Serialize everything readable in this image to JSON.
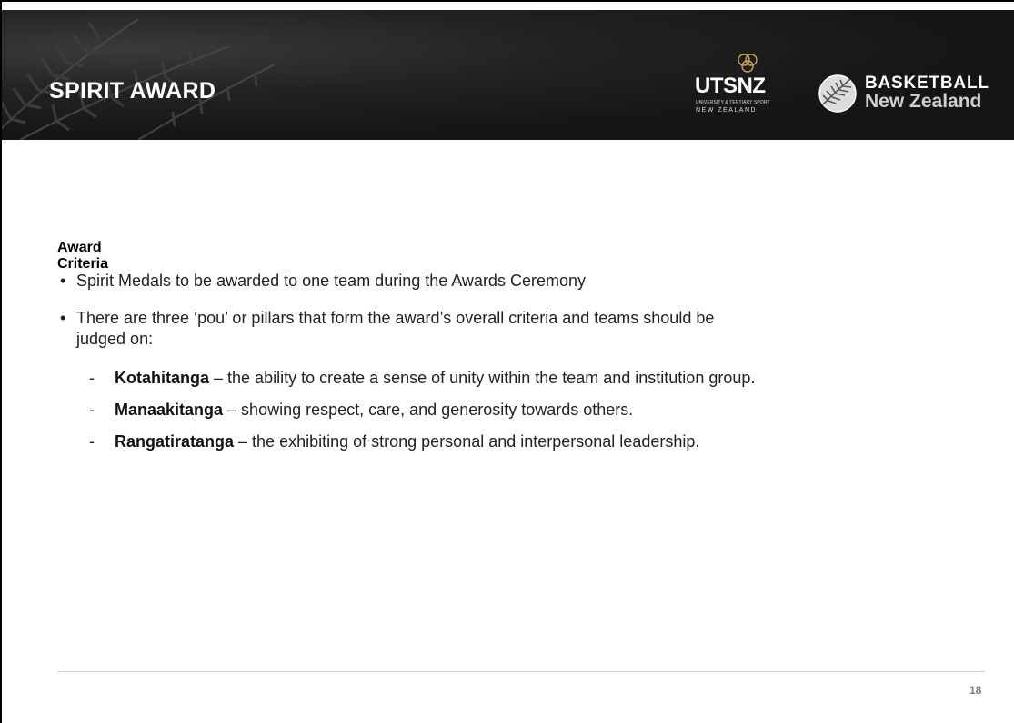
{
  "header": {
    "title": "SPIRIT AWARD",
    "logos": {
      "utsnz": {
        "word": "UTSNZ",
        "subline1": "UNIVERSITY & TERTIARY SPORT",
        "subline2": "NEW ZEALAND"
      },
      "bnz": {
        "line1": "BASKETBALL",
        "line2": "New Zealand"
      }
    },
    "colors": {
      "banner": "#1a1a1a",
      "title": "#ffffff"
    }
  },
  "body": {
    "heading": "Award Criteria",
    "bullets": [
      {
        "marker": "•",
        "text": "Spirit Medals to be awarded to one team during the Awards Ceremony"
      },
      {
        "marker": "•",
        "text": "There are three ‘pou’ or pillars that form the award’s overall criteria and teams should be",
        "continuation": "judged on:"
      }
    ],
    "pillars": [
      {
        "marker": "-",
        "term": "Kotahitanga",
        "desc": " – the ability to create a sense of unity within the team and institution group."
      },
      {
        "marker": "-",
        "term": "Manaakitanga",
        "desc": " – showing respect, care, and generosity towards others."
      },
      {
        "marker": "-",
        "term": "Rangatiratanga",
        "desc": " – the exhibiting of strong personal and interpersonal leadership."
      }
    ]
  },
  "footer": {
    "page_number": "18"
  }
}
